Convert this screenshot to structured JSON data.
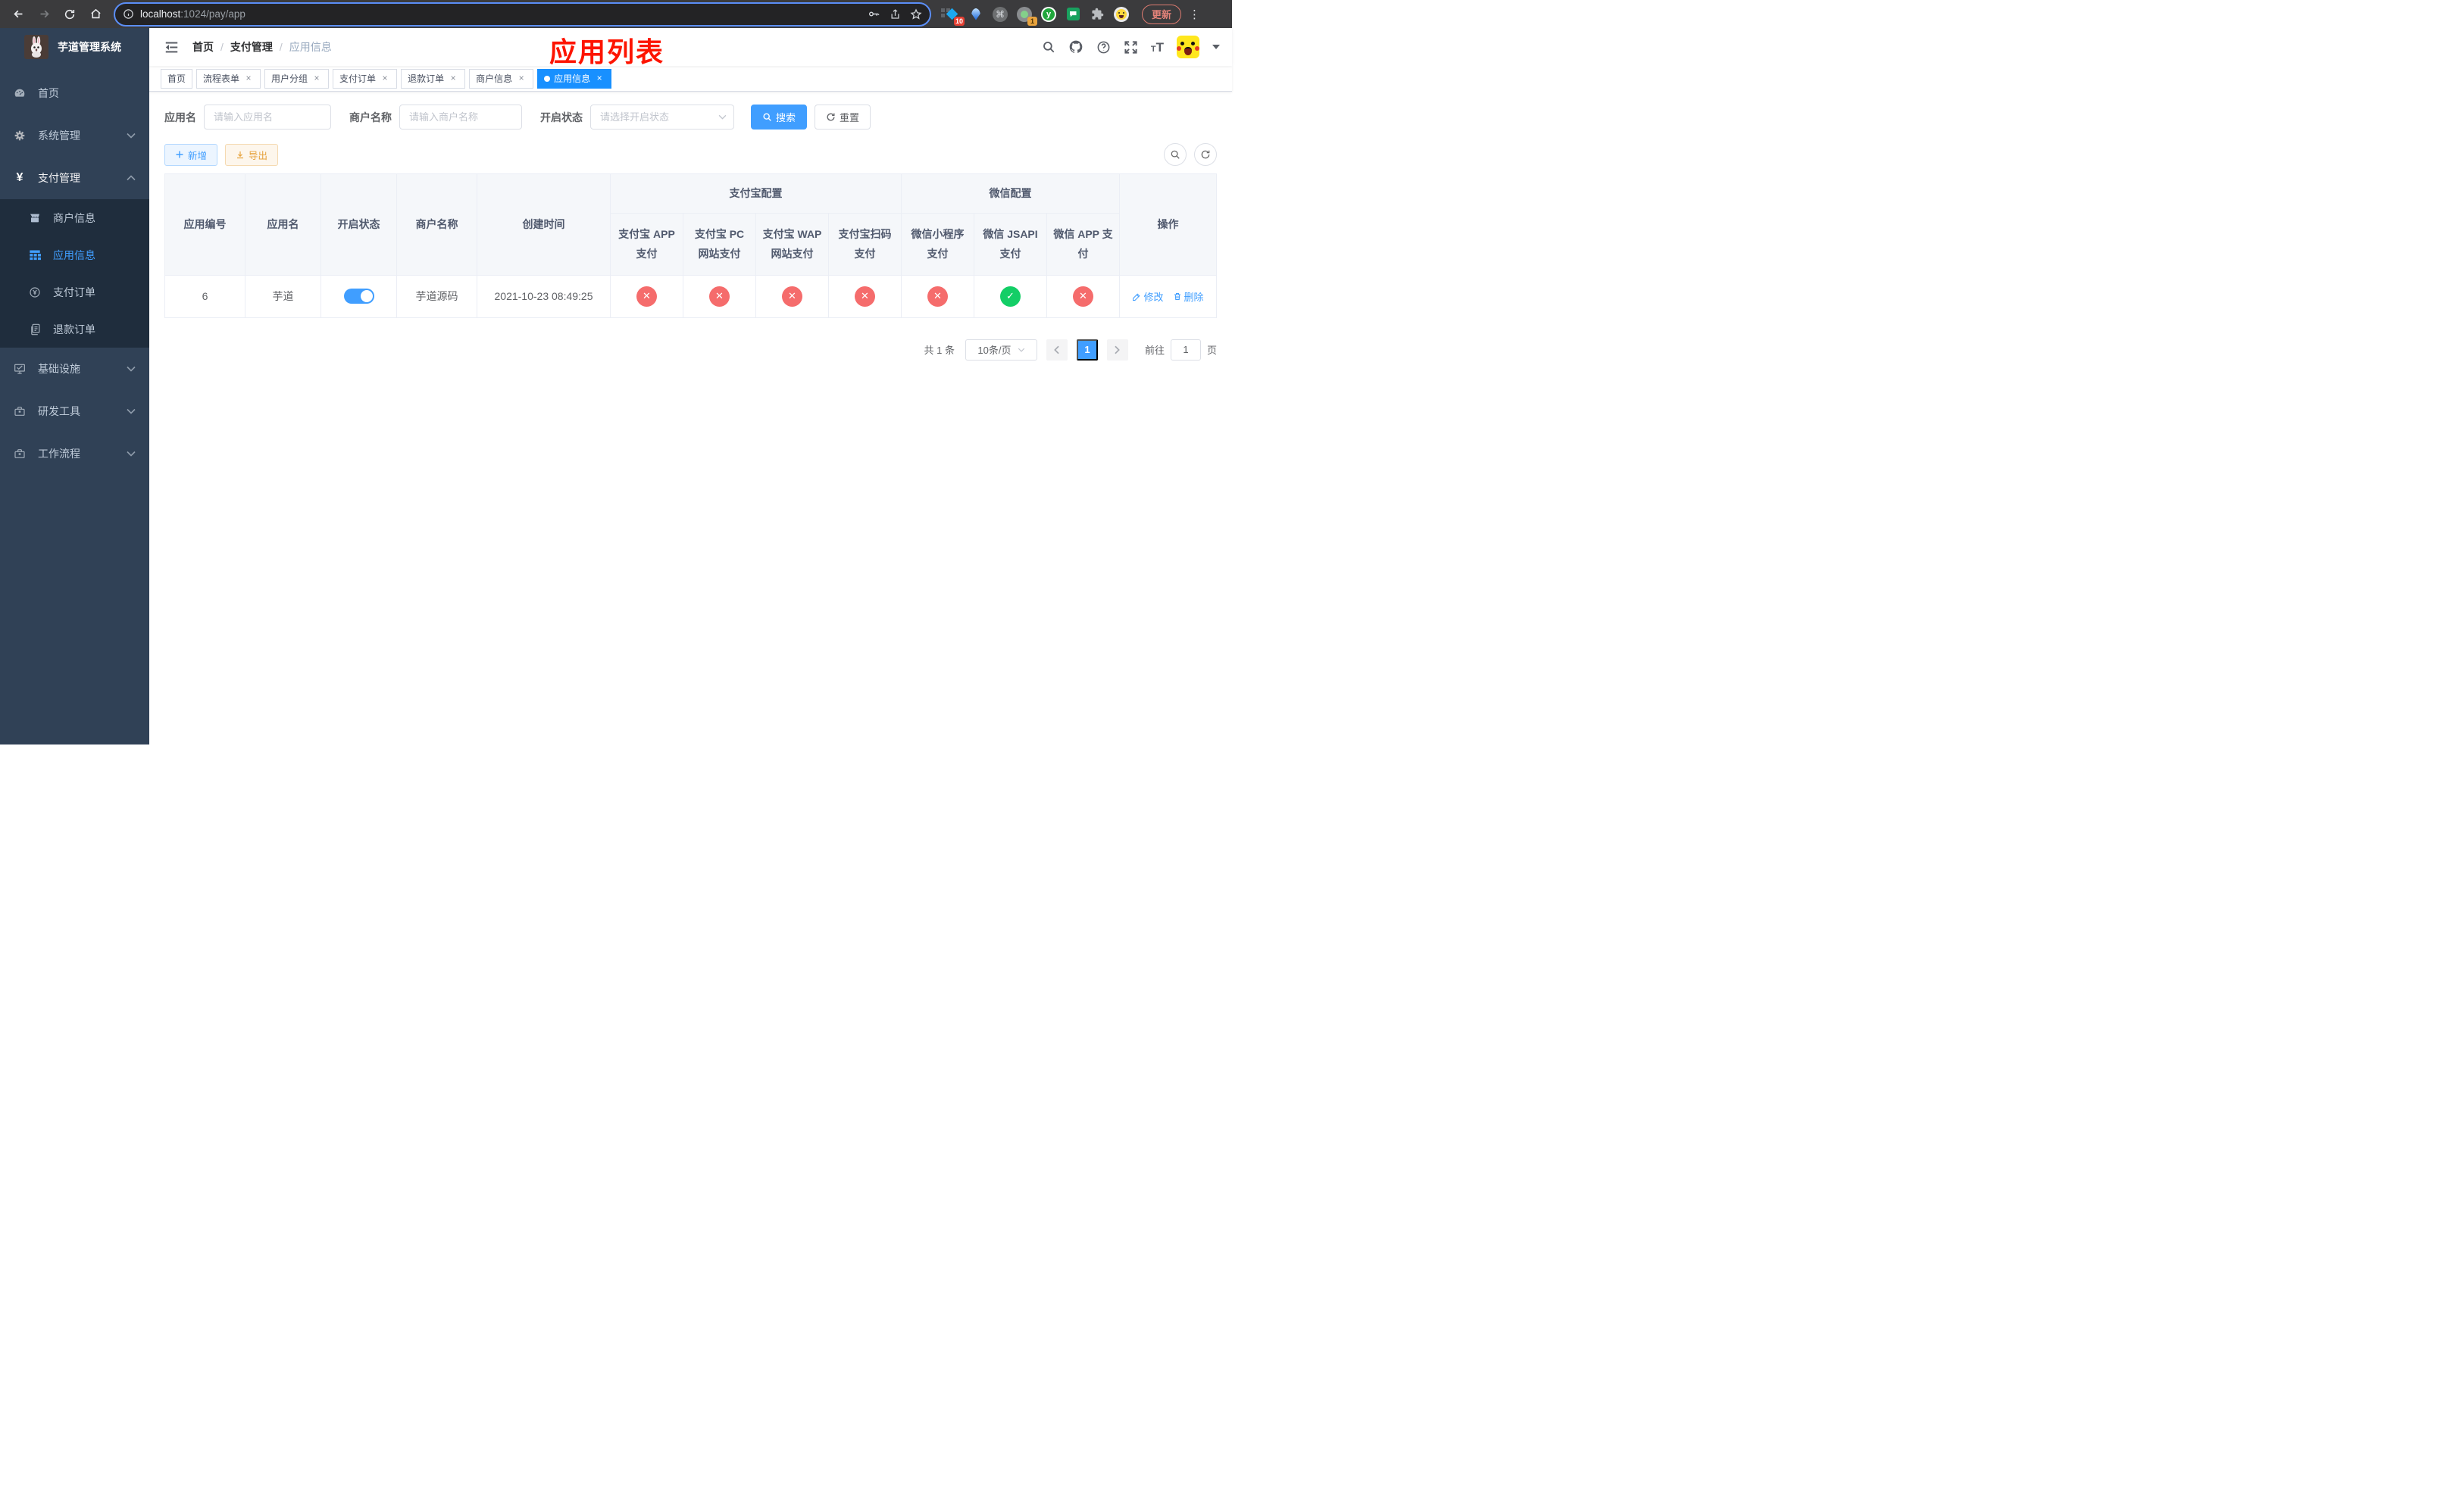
{
  "colors": {
    "primary": "#409eff",
    "tab_active": "#1890ff",
    "danger": "#f56c6c",
    "success": "#13ce66",
    "warning": "#e6a23c"
  },
  "browser": {
    "url": {
      "host": "localhost",
      "path": ":1024/pay/app"
    },
    "update_label": "更新",
    "badges": {
      "ext_blue": "10",
      "ext_gray": "1"
    },
    "ext_y_letter": "y",
    "cmd_glyph": "⌘"
  },
  "sidebar": {
    "title": "芋道管理系统",
    "items": {
      "home": "首页",
      "system": "系统管理",
      "payment": "支付管理",
      "infra": "基础设施",
      "devtools": "研发工具",
      "workflow": "工作流程"
    },
    "payment_children": {
      "merchant": "商户信息",
      "app": "应用信息",
      "pay_order": "支付订单",
      "refund_order": "退款订单"
    },
    "yen_symbol": "¥"
  },
  "breadcrumb": {
    "l1": "首页",
    "l2": "支付管理",
    "l3": "应用信息",
    "sep": "/"
  },
  "annotation": "应用列表",
  "tabs": [
    {
      "label": "首页"
    },
    {
      "label": "流程表单"
    },
    {
      "label": "用户分组"
    },
    {
      "label": "支付订单"
    },
    {
      "label": "退款订单"
    },
    {
      "label": "商户信息"
    },
    {
      "label": "应用信息"
    }
  ],
  "tab_close_glyph": "×",
  "filters": {
    "app_name_label": "应用名",
    "app_name_placeholder": "请输入应用名",
    "merchant_label": "商户名称",
    "merchant_placeholder": "请输入商户名称",
    "status_label": "开启状态",
    "status_placeholder": "请选择开启状态",
    "search_label": "搜索",
    "reset_label": "重置"
  },
  "toolbar": {
    "add_label": "新增",
    "export_label": "导出"
  },
  "table": {
    "headers": {
      "app_id": "应用编号",
      "app_name": "应用名",
      "status": "开启状态",
      "merchant_name": "商户名称",
      "create_time": "创建时间",
      "alipay_group": "支付宝配置",
      "wechat_group": "微信配置",
      "actions": "操作",
      "sub": [
        "支付宝 APP 支付",
        "支付宝 PC 网站支付",
        "支付宝 WAP 网站支付",
        "支付宝扫码支付",
        "微信小程序支付",
        "微信 JSAPI 支付",
        "微信 APP 支付"
      ]
    },
    "row": {
      "app_id": "6",
      "app_name": "芋道",
      "enabled": true,
      "merchant_name": "芋道源码",
      "create_time": "2021-10-23 08:49:25",
      "configs": [
        "error",
        "error",
        "error",
        "error",
        "error",
        "success",
        "error"
      ],
      "edit_label": "修改",
      "delete_label": "删除"
    }
  },
  "pagination": {
    "total": "共 1 条",
    "page_size": "10条/页",
    "current_page": "1",
    "goto_label": "前往",
    "goto_value": "1",
    "goto_suffix": "页"
  }
}
